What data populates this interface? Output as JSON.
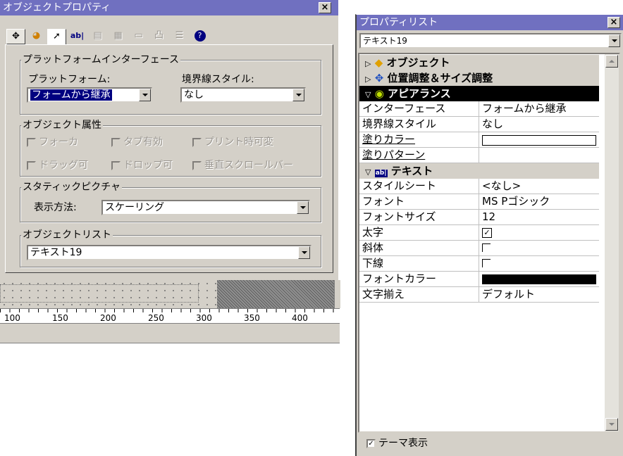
{
  "left_window": {
    "title": "オブジェクトプロパティ",
    "close_label": "×",
    "tabs": [
      "✥",
      "◕",
      "➚",
      "ab|",
      "▤",
      "▦",
      "▭",
      "凸",
      "☰",
      "?"
    ],
    "platform_group": {
      "label": "プラットフォームインターフェース",
      "platform_label": "プラットフォーム:",
      "platform_value": "フォームから継承",
      "border_label": "境界線スタイル:",
      "border_value": "なし"
    },
    "attributes_group": {
      "label": "オブジェクト属性",
      "checks": [
        "フォーカ",
        "タブ有効",
        "プリント時可変",
        "ドラッグ可",
        "ドロップ可",
        "垂直スクロールバー"
      ]
    },
    "picture_group": {
      "label": "スタティックピクチャ",
      "display_label": "表示方法:",
      "display_value": "スケーリング"
    },
    "object_list_group": {
      "label": "オブジェクトリスト",
      "value": "テキスト19"
    },
    "ruler_ticks": [
      "100",
      "150",
      "200",
      "250",
      "300",
      "350",
      "400"
    ]
  },
  "right_window": {
    "title": "プロパティリスト",
    "close_label": "×",
    "object_select": "テキスト19",
    "categories": [
      {
        "name": "オブジェクト",
        "icon": "object-cube-icon"
      },
      {
        "name": "位置調整＆サイズ調整",
        "icon": "move-arrows-icon"
      },
      {
        "name": "アピアランス",
        "icon": "eye-icon"
      },
      {
        "name": "テキスト",
        "icon": "text-field-icon"
      }
    ],
    "appearance_rows": [
      {
        "label": "インターフェース",
        "value": "フォームから継承"
      },
      {
        "label": "境界線スタイル",
        "value": "なし"
      },
      {
        "label": "塗りカラー",
        "value": ""
      },
      {
        "label": "塗りパターン",
        "value": ""
      }
    ],
    "text_rows": [
      {
        "label": "スタイルシート",
        "value": "<なし>"
      },
      {
        "label": "フォント",
        "value": "MS Pゴシック"
      },
      {
        "label": "フォントサイズ",
        "value": "12"
      },
      {
        "label": "太字",
        "value": ""
      },
      {
        "label": "斜体",
        "value": ""
      },
      {
        "label": "下線",
        "value": ""
      },
      {
        "label": "フォントカラー",
        "value": ""
      },
      {
        "label": "文字揃え",
        "value": "デフォルト"
      }
    ],
    "checkbox_states": {
      "bold": true,
      "italic": false,
      "underline": false
    },
    "colors": {
      "fill_color": "#ffffff",
      "font_color": "#000000"
    },
    "theme_label": "テーマ表示",
    "theme_checked": true
  }
}
